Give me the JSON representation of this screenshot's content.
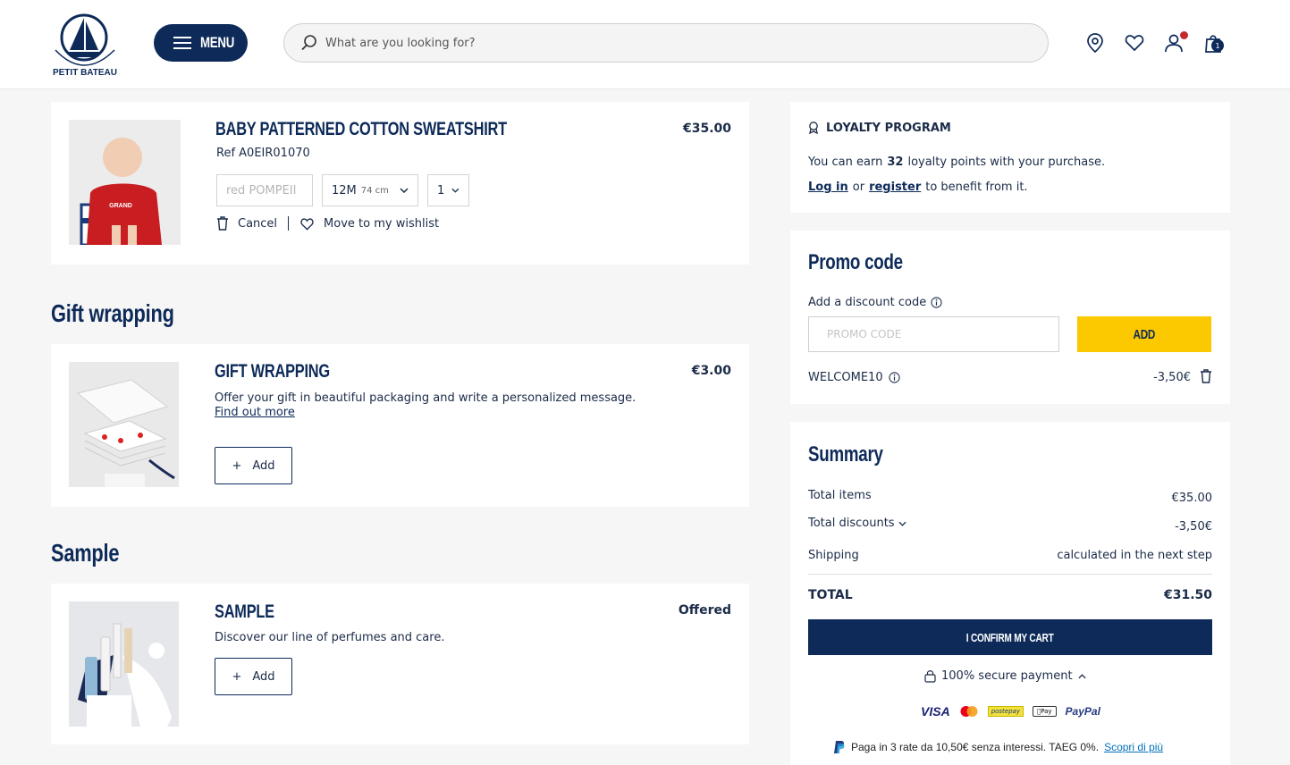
{
  "header": {
    "menu_label": "MENU",
    "search_placeholder": "What are you looking for?",
    "cart_count": "1"
  },
  "cart_item": {
    "title": "BABY PATTERNED COTTON SWEATSHIRT",
    "ref": "Ref A0EIR01070",
    "price": "€35.00",
    "color": "red POMPEII",
    "size_main": "12M",
    "size_sub": "74 cm",
    "quantity": "1",
    "cancel_label": "Cancel",
    "wishlist_label": "Move to my wishlist"
  },
  "gift": {
    "section_title": "Gift wrapping",
    "title": "GIFT WRAPPING",
    "price": "€3.00",
    "description": "Offer your gift in beautiful packaging and write a personalized message.",
    "link": "Find out more",
    "add_label": "Add"
  },
  "sample": {
    "section_title": "Sample",
    "title": "SAMPLE",
    "price": "Offered",
    "description": "Discover our line of perfumes and care.",
    "add_label": "Add"
  },
  "loyalty": {
    "title": "LOYALTY PROGRAM",
    "line1_pre": "You can earn",
    "points": "32",
    "line1_post": "loyalty points with your purchase.",
    "login": "Log in",
    "or": "or",
    "register": "register",
    "line2_post": "to benefit from it."
  },
  "promo": {
    "title": "Promo code",
    "label": "Add a discount code",
    "placeholder": "PROMO CODE",
    "add_label": "ADD",
    "applied_code": "WELCOME10",
    "applied_amount": "-3,50€"
  },
  "summary": {
    "title": "Summary",
    "items_label": "Total items",
    "items_value": "€35.00",
    "discounts_label": "Total discounts",
    "discounts_value": "-3,50€",
    "shipping_label": "Shipping",
    "shipping_value": "calculated in the next step",
    "total_label": "TOTAL",
    "total_value": "€31.50",
    "confirm_label": "I CONFIRM MY CART",
    "secure_label": "100% secure payment",
    "payments": [
      "VISA",
      "postepay",
      "Pay",
      "PayPal"
    ],
    "paypal_text": "Paga in 3 rate da 10,50€ senza interessi. TAEG 0%.",
    "paypal_link": "Scopri di più"
  },
  "colors": {
    "navy": "#0d2a59",
    "yellow": "#fcc900",
    "background": "#f6f6f6"
  }
}
